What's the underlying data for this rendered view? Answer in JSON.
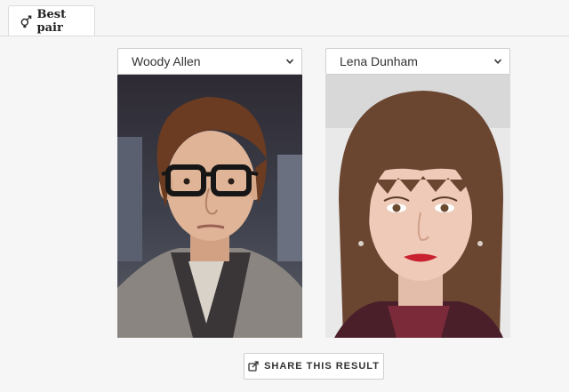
{
  "tabs": [
    {
      "label": "Best pair",
      "icon": "gender-pair-icon",
      "active": true
    }
  ],
  "left_person": {
    "selected": "Woody Allen",
    "photo_alt": "Woody Allen"
  },
  "right_person": {
    "selected": "Lena Dunham",
    "photo_alt": "Lena Dunham"
  },
  "share_button": {
    "label": "SHARE THIS RESULT",
    "icon": "share-icon"
  }
}
